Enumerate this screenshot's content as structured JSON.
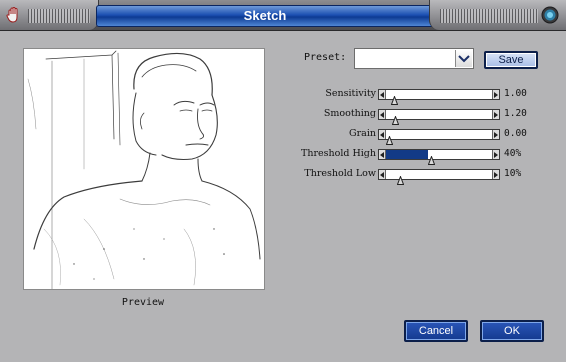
{
  "window": {
    "title": "Sketch"
  },
  "preview": {
    "label": "Preview"
  },
  "preset": {
    "label": "Preset:",
    "value": "",
    "save_label": "Save"
  },
  "sliders": [
    {
      "label": "Sensitivity",
      "value_text": "1.00",
      "level": 0.05,
      "filled": false
    },
    {
      "label": "Smoothing",
      "value_text": "1.20",
      "level": 0.06,
      "filled": false
    },
    {
      "label": "Grain",
      "value_text": "0.00",
      "level": 0.0,
      "filled": false
    },
    {
      "label": "Threshold High",
      "value_text": "40%",
      "level": 0.4,
      "filled": true
    },
    {
      "label": "Threshold Low",
      "value_text": "10%",
      "level": 0.1,
      "filled": false
    }
  ],
  "buttons": {
    "cancel": "Cancel",
    "ok": "OK"
  },
  "icons": {
    "window_menu": "hand-icon",
    "close": "close-icon",
    "dropdown": "chevron-down-icon"
  },
  "colors": {
    "title_blue": "#1b4fb2",
    "button_blue": "#143a8f",
    "dialog_gray": "#b4b4b6"
  }
}
